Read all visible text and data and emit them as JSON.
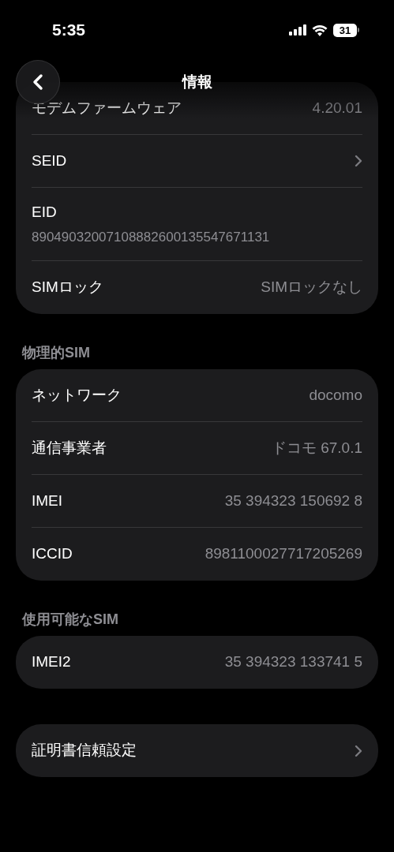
{
  "status_bar": {
    "time": "5:35",
    "battery": "31"
  },
  "nav": {
    "title": "情報"
  },
  "sections": [
    {
      "rows": [
        {
          "kind": "value",
          "label": "モデムファームウェア",
          "value": "4.20.01"
        },
        {
          "kind": "chevron",
          "label": "SEID"
        },
        {
          "kind": "stacked",
          "label": "EID",
          "value": "89049032007108882600135547671131"
        },
        {
          "kind": "value",
          "label": "SIMロック",
          "value": "SIMロックなし"
        }
      ]
    },
    {
      "header": "物理的SIM",
      "rows": [
        {
          "kind": "value",
          "label": "ネットワーク",
          "value": "docomo"
        },
        {
          "kind": "value",
          "label": "通信事業者",
          "value": "ドコモ 67.0.1"
        },
        {
          "kind": "value",
          "label": "IMEI",
          "value": "35 394323 150692 8"
        },
        {
          "kind": "value",
          "label": "ICCID",
          "value": "8981100027717205269"
        }
      ]
    },
    {
      "header": "使用可能なSIM",
      "rows": [
        {
          "kind": "value",
          "label": "IMEI2",
          "value": "35 394323 133741 5"
        }
      ]
    },
    {
      "rows": [
        {
          "kind": "chevron",
          "label": "証明書信頼設定"
        }
      ]
    }
  ]
}
